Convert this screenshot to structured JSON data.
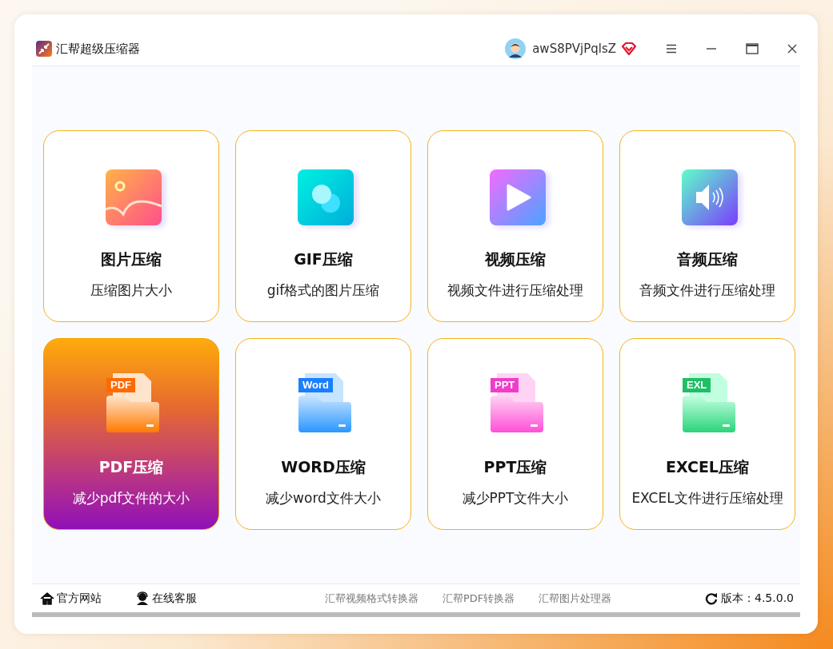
{
  "window": {
    "title": "汇帮超级压缩器",
    "user": "awS8PVjPqlsZ"
  },
  "cards": [
    {
      "kind": "image",
      "title": "图片压缩",
      "subtitle": "压缩图片大小",
      "selected": false
    },
    {
      "kind": "gif",
      "title": "GIF压缩",
      "subtitle": "gif格式的图片压缩",
      "selected": false
    },
    {
      "kind": "video",
      "title": "视频压缩",
      "subtitle": "视频文件进行压缩处理",
      "selected": false
    },
    {
      "kind": "audio",
      "title": "音频压缩",
      "subtitle": "音频文件进行压缩处理",
      "selected": false
    },
    {
      "kind": "pdf",
      "icon_label": "PDF",
      "title": "PDF压缩",
      "subtitle": "减少pdf文件的大小",
      "selected": true
    },
    {
      "kind": "word",
      "icon_label": "Word",
      "title": "WORD压缩",
      "subtitle": "减少word文件大小",
      "selected": false
    },
    {
      "kind": "ppt",
      "icon_label": "PPT",
      "title": "PPT压缩",
      "subtitle": "减少PPT文件大小",
      "selected": false
    },
    {
      "kind": "excel",
      "icon_label": "EXL",
      "title": "EXCEL压缩",
      "subtitle": "EXCEL文件进行压缩处理",
      "selected": false
    }
  ],
  "footer": {
    "left": [
      {
        "kind": "home",
        "label": "官方网站"
      },
      {
        "kind": "support",
        "label": "在线客服"
      }
    ],
    "links": [
      "汇帮视频格式转换器",
      "汇帮PDF转换器",
      "汇帮图片处理器"
    ],
    "version": "版本：4.5.0.0"
  }
}
